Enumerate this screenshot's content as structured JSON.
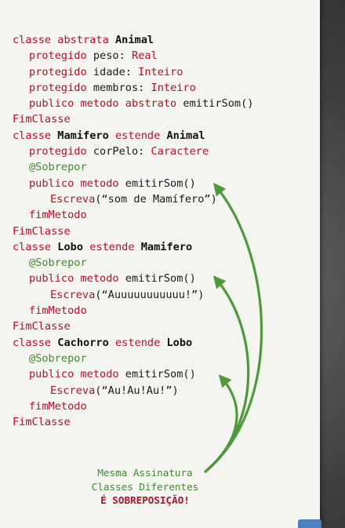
{
  "code": {
    "l1": {
      "kw1": "classe abstrata ",
      "name": "Animal"
    },
    "l2": {
      "kw": "protegido ",
      "text": "peso: ",
      "type": "Real"
    },
    "l3": {
      "kw": "protegido ",
      "text": "idade: ",
      "type": "Inteiro"
    },
    "l4": {
      "kw": "protegido ",
      "text": "membros: ",
      "type": "Inteiro"
    },
    "l5": {
      "kw": "publico metodo abstrato ",
      "text": "emitirSom()"
    },
    "l6": {
      "kw": "FimClasse"
    },
    "l7": {
      "kw1": "classe ",
      "name": "Mamifero",
      "kw2": " estende ",
      "parent": "Animal"
    },
    "l8": {
      "kw": "protegido ",
      "text": "corPelo: ",
      "type": "Caractere"
    },
    "l9": {
      "ann": "@Sobrepor"
    },
    "l10": {
      "kw": "publico metodo ",
      "text": "emitirSom()"
    },
    "l11": {
      "kw": "Escreva",
      "str": "(“som de Mamífero”)"
    },
    "l12": {
      "kw": "fimMetodo"
    },
    "l13": {
      "kw": "FimClasse"
    },
    "l14": {
      "kw1": "classe ",
      "name": "Lobo",
      "kw2": " estende ",
      "parent": "Mamifero"
    },
    "l15": {
      "ann": "@Sobrepor"
    },
    "l16": {
      "kw": "publico metodo ",
      "text": "emitirSom()"
    },
    "l17": {
      "kw": "Escreva",
      "str": "(“Auuuuuuuuuuu!”)"
    },
    "l18": {
      "kw": "fimMetodo"
    },
    "l19": {
      "kw": "FimClasse"
    },
    "l20": {
      "kw1": "classe ",
      "name": "Cachorro",
      "kw2": " estende ",
      "parent": "Lobo"
    },
    "l21": {
      "ann": "@Sobrepor"
    },
    "l22": {
      "kw": "publico metodo ",
      "text": "emitirSom()"
    },
    "l23": {
      "kw": "Escreva",
      "str": "(“Au!Au!Au!”)"
    },
    "l24": {
      "kw": "fimMetodo"
    },
    "l25": {
      "kw": "FimClasse"
    }
  },
  "note": {
    "line1": "Mesma Assinatura",
    "line2": "Classes Diferentes",
    "line3": "É SOBREPOSIÇÃO!"
  },
  "colors": {
    "keyword": "#b1122b",
    "annotation": "#3f8b2e",
    "arrow": "#4f9a3a"
  }
}
